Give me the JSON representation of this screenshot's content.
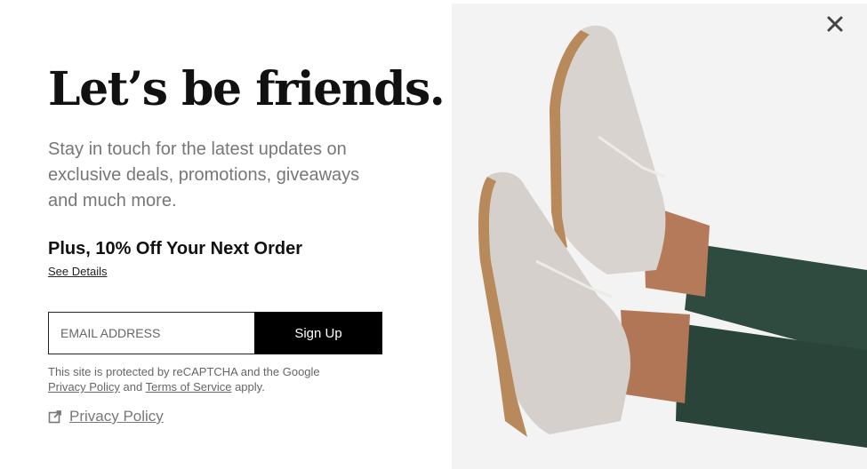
{
  "modal": {
    "headline": "Let’s be friends.",
    "subtext": "Stay in touch for the latest updates on exclusive deals, promotions, giveaways and much more.",
    "offer": "Plus, 10% Off Your Next Order",
    "see_details": "See Details",
    "email_placeholder": "EMAIL ADDRESS",
    "email_value": "",
    "signup_label": "Sign Up",
    "legal": {
      "prefix": "This site is protected by reCAPTCHA and the Google",
      "privacy_link": "Privacy Policy",
      "and": "and",
      "terms_link": "Terms of Service",
      "suffix": "apply."
    },
    "privacy_policy_link": "Privacy Policy",
    "close_icon": "close-icon",
    "external_icon": "external-link-icon"
  },
  "colors": {
    "text_dark": "#111111",
    "text_muted": "#777777",
    "button_bg": "#000000",
    "button_text": "#ffffff",
    "pants": "#2f4a3f",
    "boot_suede": "#d9d3cf",
    "sole": "#b8895a"
  }
}
